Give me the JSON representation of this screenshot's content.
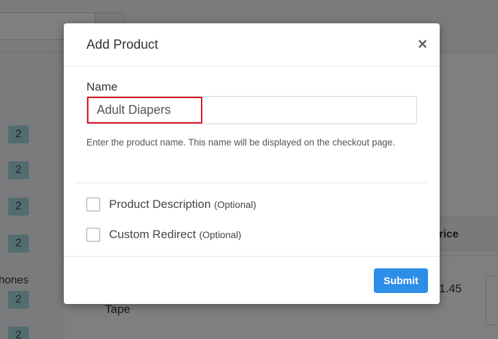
{
  "background": {
    "sidebar_badges": [
      "2",
      "2",
      "2",
      "2",
      "2",
      "2"
    ],
    "sidebar_text": "hones",
    "table_header": "rice",
    "cell_price": "1.45",
    "cell_name": "Tape"
  },
  "modal": {
    "title": "Add Product",
    "close_label": "×",
    "name_label": "Name",
    "name_value": "Adult Diapers",
    "help_text": "Enter the product name. This name will be displayed on the checkout page.",
    "options": [
      {
        "label": "Product Description",
        "optional": "(Optional)",
        "checked": false
      },
      {
        "label": "Custom Redirect",
        "optional": "(Optional)",
        "checked": false
      }
    ],
    "submit_label": "Submit"
  },
  "colors": {
    "accent": "#2d8ee8",
    "highlight": "#e0101e",
    "badge": "#a7d9df"
  }
}
